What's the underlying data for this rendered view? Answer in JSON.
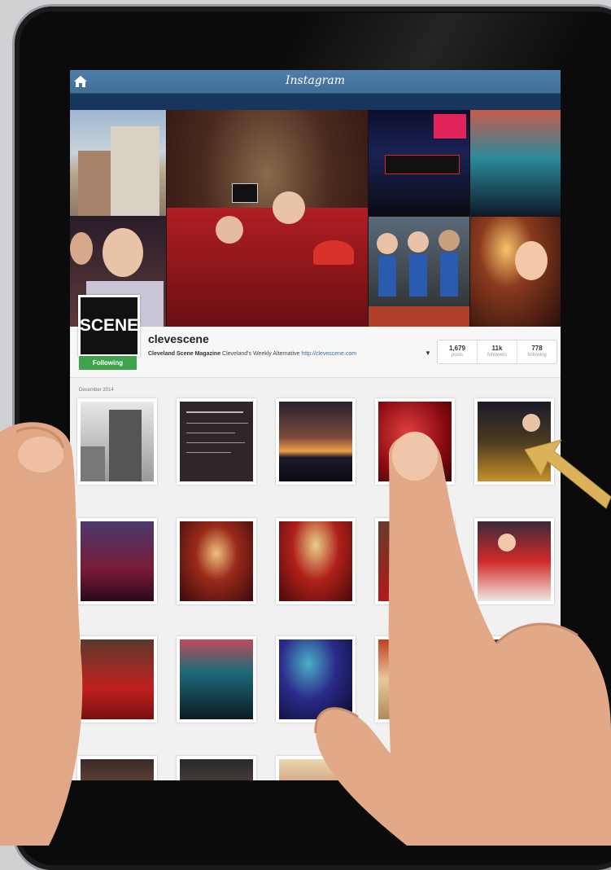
{
  "app": {
    "title": "Instagram"
  },
  "profile": {
    "avatar_text": "SCENE",
    "follow_button": "Following",
    "username": "clevescene",
    "bio_name": "Cleveland Scene Magazine",
    "bio_text": "Cleveland's Weekly Alternative",
    "bio_link": "http://clevescene.com"
  },
  "stats": [
    {
      "num": "1,679",
      "label": "posts"
    },
    {
      "num": "11k",
      "label": "followers"
    },
    {
      "num": "778",
      "label": "following"
    }
  ],
  "feed": {
    "date_label": "December 2014"
  },
  "colors": {
    "header": "#3f6e97",
    "follow_green": "#3ea34a",
    "arrow": "#d9b25a"
  }
}
